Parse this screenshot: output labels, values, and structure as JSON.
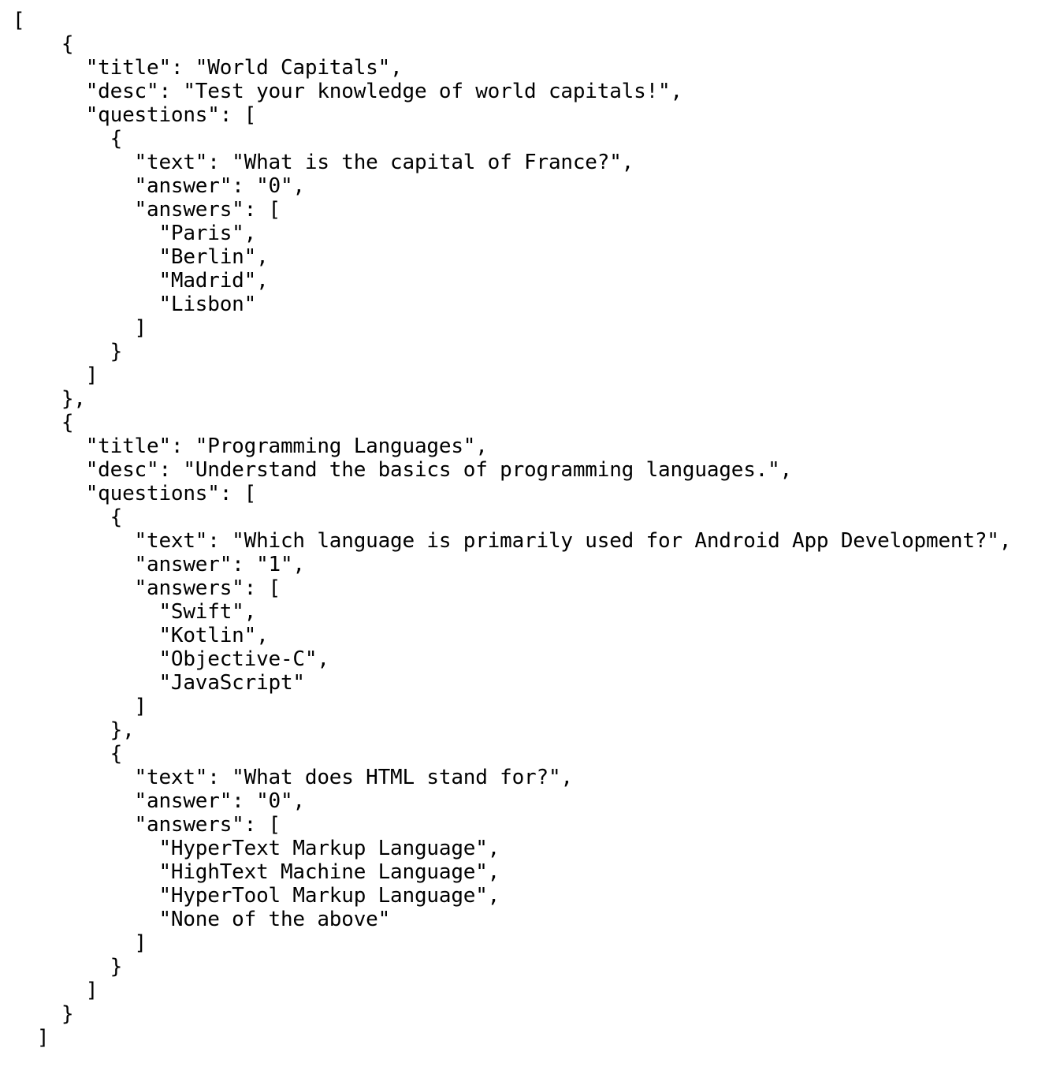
{
  "document": {
    "lines": [
      "[",
      "    {",
      "      \"title\": \"World Capitals\",",
      "      \"desc\": \"Test your knowledge of world capitals!\",",
      "      \"questions\": [",
      "        {",
      "          \"text\": \"What is the capital of France?\",",
      "          \"answer\": \"0\",",
      "          \"answers\": [",
      "            \"Paris\",",
      "            \"Berlin\",",
      "            \"Madrid\",",
      "            \"Lisbon\"",
      "          ]",
      "        }",
      "      ]",
      "    },",
      "    {",
      "      \"title\": \"Programming Languages\",",
      "      \"desc\": \"Understand the basics of programming languages.\",",
      "      \"questions\": [",
      "        {",
      "          \"text\": \"Which language is primarily used for Android App Development?\",",
      "          \"answer\": \"1\",",
      "          \"answers\": [",
      "            \"Swift\",",
      "            \"Kotlin\",",
      "            \"Objective-C\",",
      "            \"JavaScript\"",
      "          ]",
      "        },",
      "        {",
      "          \"text\": \"What does HTML stand for?\",",
      "          \"answer\": \"0\",",
      "          \"answers\": [",
      "            \"HyperText Markup Language\",",
      "            \"HighText Machine Language\",",
      "            \"HyperTool Markup Language\",",
      "            \"None of the above\"",
      "          ]",
      "        }",
      "      ]",
      "    }",
      "  ]"
    ]
  }
}
